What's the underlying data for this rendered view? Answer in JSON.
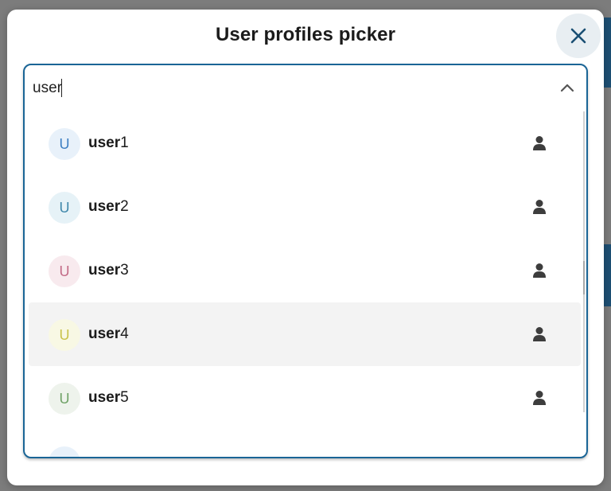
{
  "dialog": {
    "title": "User profiles picker",
    "close_icon": "close-icon"
  },
  "search": {
    "value": "user",
    "toggle_icon": "chevron-up-icon"
  },
  "options": [
    {
      "match": "user",
      "rest": "1",
      "avatar_letter": "U",
      "avatar_bg": "#e8f1fa",
      "avatar_color": "#3d7fc2",
      "icon": "person-icon",
      "highlighted": false
    },
    {
      "match": "user",
      "rest": "2",
      "avatar_letter": "U",
      "avatar_bg": "#e6f2f7",
      "avatar_color": "#3f87aa",
      "icon": "person-icon",
      "highlighted": false
    },
    {
      "match": "user",
      "rest": "3",
      "avatar_letter": "U",
      "avatar_bg": "#f8eaee",
      "avatar_color": "#c26a86",
      "icon": "person-icon",
      "highlighted": false
    },
    {
      "match": "user",
      "rest": "4",
      "avatar_letter": "U",
      "avatar_bg": "#f8f8e4",
      "avatar_color": "#c9c24a",
      "icon": "person-icon",
      "highlighted": true
    },
    {
      "match": "user",
      "rest": "5",
      "avatar_letter": "U",
      "avatar_bg": "#eef3ec",
      "avatar_color": "#6fa266",
      "icon": "person-icon",
      "highlighted": false
    },
    {
      "match": "",
      "rest": "",
      "avatar_letter": "",
      "avatar_bg": "#e8f1fa",
      "avatar_color": "#3d7fc2",
      "icon": "",
      "highlighted": false
    }
  ],
  "colors": {
    "accent": "#1a6596",
    "highlight": "#f3f3f3"
  }
}
